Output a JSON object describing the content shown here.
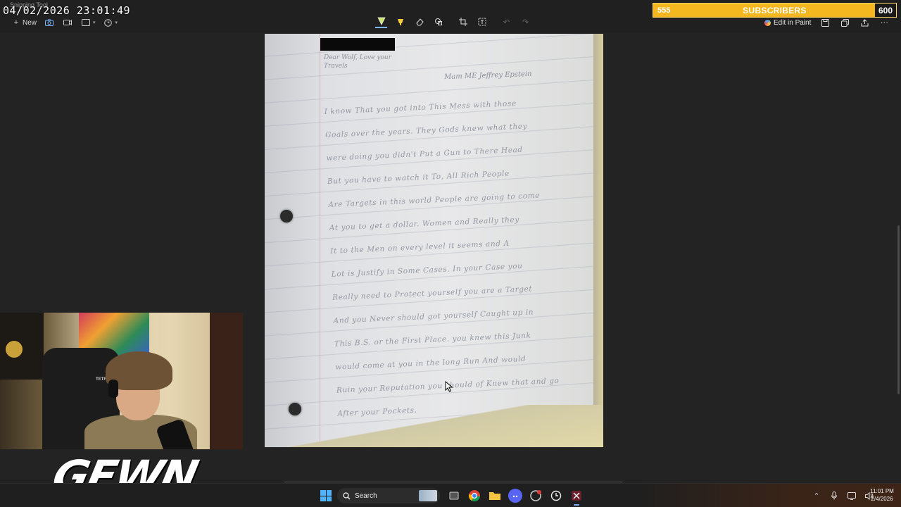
{
  "overlay": {
    "timestamp": "04/02/2026 23:01:49"
  },
  "app": {
    "title": "Snipping Tool",
    "new_label": "New",
    "edit_in_paint_label": "Edit in Paint"
  },
  "toolbar_icons": {
    "left": [
      "camera-icon",
      "video-icon",
      "rect-select-icon",
      "delay-icon"
    ],
    "center": [
      "ballpoint-pen-icon",
      "highlighter-icon",
      "eraser-icon",
      "shapes-icon",
      "crop-icon",
      "text-actions-icon",
      "undo-icon",
      "redo-icon"
    ],
    "right": [
      "save-icon",
      "copy-icon",
      "share-icon",
      "more-icon"
    ]
  },
  "subscriber_goal": {
    "current": "555",
    "label": "SUBSCRIBERS",
    "goal": "600",
    "progress": 0.925,
    "bar_color": "#f4b71f"
  },
  "letter": {
    "redacted": true,
    "corner_note": "Dear Wolf, Love your Travels",
    "heading": "Mam ME Jeffrey Epstein",
    "lines": [
      "I know That you got into This Mess with those",
      "Goals over the years. They Gods knew what they",
      "were doing you didn't Put a Gun to There Head",
      "But you have to watch it To, All Rich People",
      "Are Targets in this world People are going to come",
      "At you to get a dollar. Women and Really they",
      "It to the Men on every level it seems and A",
      "Lot is Justify in Some Cases. In your Case you",
      "Really need to Protect yourself you are a Target",
      "And you Never should got yourself Caught up in",
      "This B.S. or the First Place. you knew this Junk",
      "would come at you in the long Run And would",
      "Ruin your Reputation you should of Knew that and go",
      "After your Pockets."
    ]
  },
  "streamer": {
    "logo_text": "GEWN",
    "chair_brand": "TETRO"
  },
  "taskbar": {
    "search_placeholder": "Search",
    "apps": [
      "task-view-icon",
      "chrome-icon",
      "file-explorer-icon",
      "discord-icon",
      "app-icon",
      "clock-app-icon",
      "snipping-tool-icon"
    ],
    "tray_icons": [
      "chevron-up-icon",
      "microphone-icon",
      "display-icon",
      "volume-icon"
    ],
    "time": "11:01 PM",
    "date": "2/4/2026"
  }
}
